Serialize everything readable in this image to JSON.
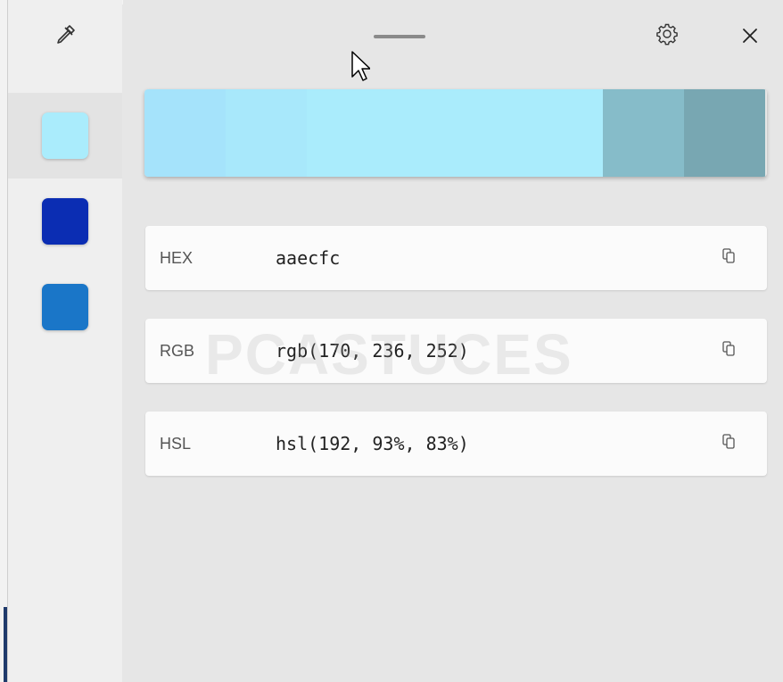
{
  "toolbar": {
    "picker_icon": "eyedropper-icon",
    "settings_icon": "gear-icon",
    "close_icon": "close-icon",
    "drag_icon": "drag-handle"
  },
  "history": [
    {
      "color": "#aaecfc",
      "selected": true
    },
    {
      "color": "#0b2db3",
      "selected": false
    },
    {
      "color": "#1a76c8",
      "selected": false
    }
  ],
  "shades": [
    "#a5e3fb",
    "#a8e8fb",
    "#aaecfc",
    "#86bcc9",
    "#78a7b2"
  ],
  "formats": [
    {
      "label": "HEX",
      "value": "aaecfc"
    },
    {
      "label": "RGB",
      "value": "rgb(170, 236, 252)"
    },
    {
      "label": "HSL",
      "value": "hsl(192, 93%, 83%)"
    }
  ],
  "watermark": {
    "text": "PCASTUCES"
  }
}
